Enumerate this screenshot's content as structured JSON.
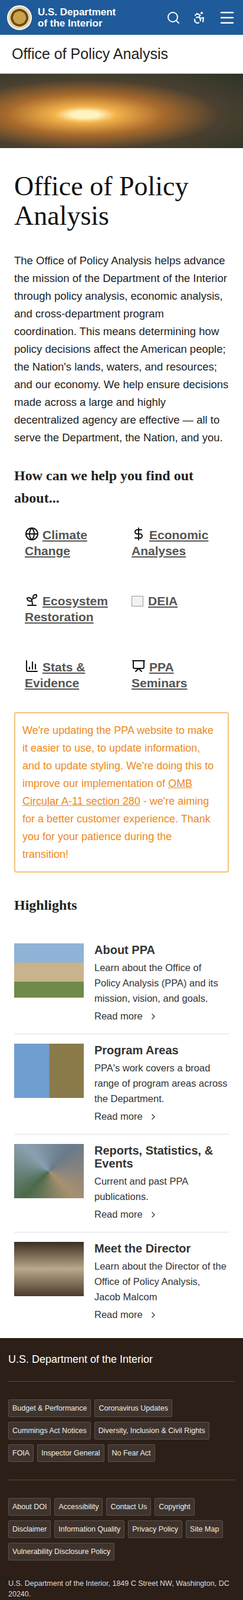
{
  "header": {
    "title": "U.S. Department of the Interior"
  },
  "subheader": {
    "title": "Office of Policy Analysis"
  },
  "page": {
    "heading": "Office of Policy Analysis",
    "intro": "The Office of Policy Analysis helps advance the mission of the Department of the Interior through policy analysis, economic analysis, and cross-department program coordination. This means determining how policy decisions affect the American people; the Nation's lands, waters, and resources; and our economy. We help ensure decisions made across a large and highly decentralized agency are effective — all to serve the Department, the Nation, and you."
  },
  "help": {
    "heading": "How can we help you find out about...",
    "topics": [
      {
        "label": "Climate Change",
        "kind": "globe"
      },
      {
        "label": "Economic Analyses",
        "kind": "dollar"
      },
      {
        "label": "Ecosystem Restoration",
        "kind": "sprout"
      },
      {
        "label": "DEIA",
        "kind": "image"
      },
      {
        "label": "Stats & Evidence",
        "kind": "chart"
      },
      {
        "label": "PPA Seminars",
        "kind": "presentation"
      }
    ]
  },
  "notice": {
    "before": "We're updating the PPA website to make it easier to use, to update information, and to update styling. We're doing this to improve our implementation of ",
    "link": "OMB Circular A-11 section 280",
    "after": " - we're aiming for a better customer experience. Thank you for your patience during the transition!"
  },
  "highlights": {
    "heading": "Highlights",
    "cards": [
      {
        "title": "About PPA",
        "description": "Learn about the Office of Policy Analysis (PPA) and its mission, vision, and goals.",
        "link": "Read more"
      },
      {
        "title": "Program Areas",
        "description": "PPA's work covers a broad range of program areas across the Department.",
        "link": "Read more"
      },
      {
        "title": "Reports, Statistics, & Events",
        "description": "Current and past PPA publications.",
        "link": "Read more"
      },
      {
        "title": "Meet the Director",
        "description": "Learn about the Director of the Office of Policy Analysis, Jacob Malcom",
        "link": "Read more"
      }
    ]
  },
  "footer": {
    "title": "U.S. Department of the Interior",
    "primary_links": [
      "Budget & Performance",
      "Coronavirus Updates",
      "Cummings Act Notices",
      "Diversity, Inclusion & Civil Rights",
      "FOIA",
      "Inspector General",
      "No Fear Act"
    ],
    "secondary_links": [
      "About DOI",
      "Accessibility",
      "Contact Us",
      "Copyright",
      "Disclaimer",
      "Information Quality",
      "Privacy Policy",
      "Site Map",
      "Vulnerability Disclosure Policy"
    ],
    "address": "U.S. Department of the Interior, 1849 C Street NW, Washington, DC 20240."
  }
}
